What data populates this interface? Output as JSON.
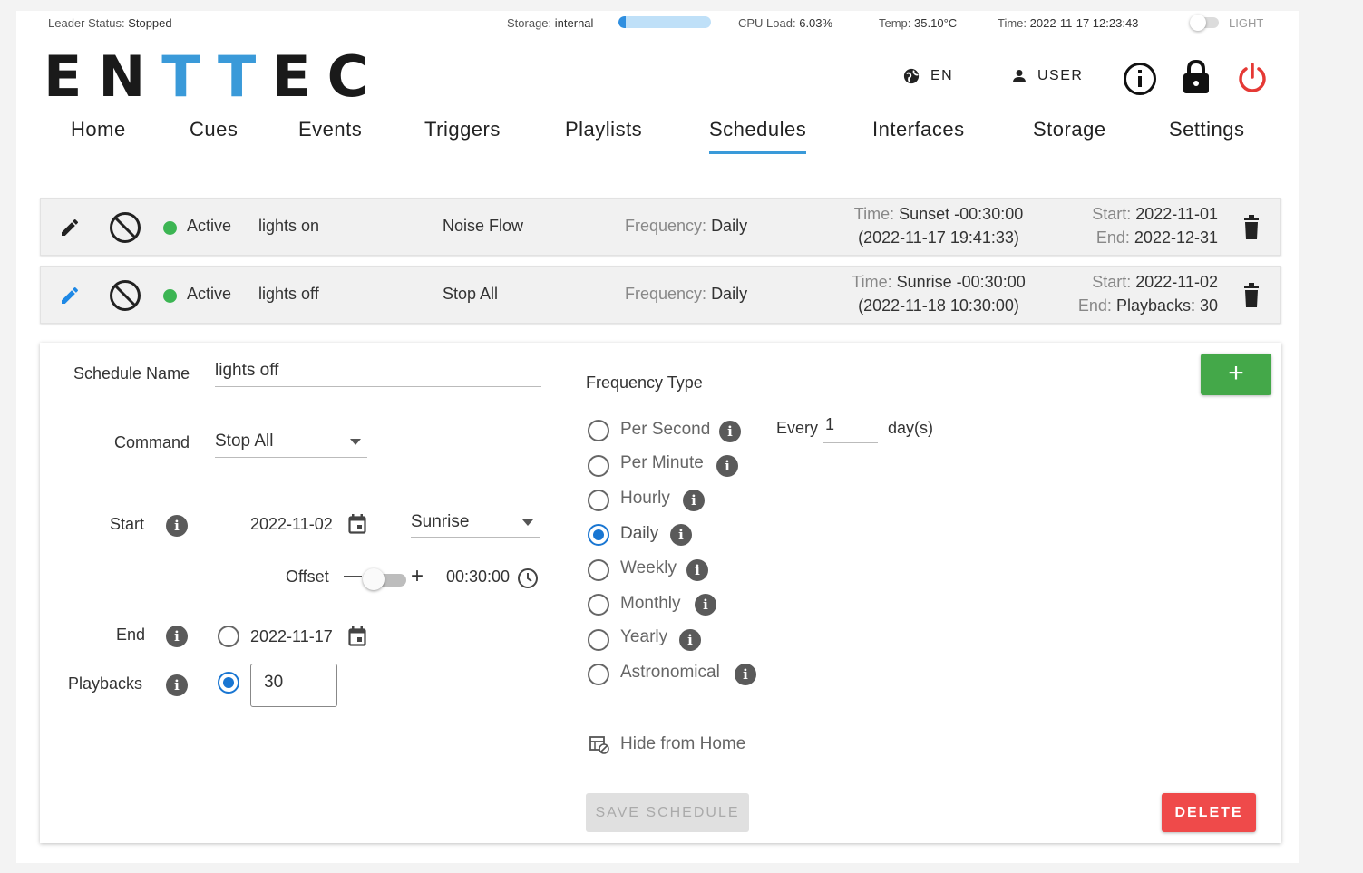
{
  "status_bar": {
    "leader_label": "Leader Status:",
    "leader_value": "Stopped",
    "storage_label": "Storage:",
    "storage_value": "internal",
    "storage_fraction": 0.08,
    "cpu_label": "CPU Load:",
    "cpu_value": "6.03%",
    "temp_label": "Temp:",
    "temp_value": "35.10°C",
    "time_label": "Time:",
    "time_value": "2022-11-17 12:23:43",
    "theme_label": "LIGHT"
  },
  "logo": {
    "part1": "EN",
    "part2": "TT",
    "part3": "EC"
  },
  "header": {
    "language": "EN",
    "user": "USER",
    "icons": [
      "globe-icon",
      "user-icon",
      "info-icon",
      "lock-icon",
      "power-icon"
    ]
  },
  "nav": {
    "items": [
      "Home",
      "Cues",
      "Events",
      "Triggers",
      "Playlists",
      "Schedules",
      "Interfaces",
      "Storage",
      "Settings"
    ],
    "active": "Schedules"
  },
  "schedules": [
    {
      "status": "Active",
      "name": "lights on",
      "command": "Noise Flow",
      "frequency_label": "Frequency:",
      "frequency": "Daily",
      "time_label": "Time:",
      "time": "Sunset -00:30:00",
      "time_next": "(2022-11-17 19:41:33)",
      "start_label": "Start:",
      "start": "2022-11-01",
      "end_label": "End:",
      "end": "2022-12-31"
    },
    {
      "status": "Active",
      "name": "lights off",
      "command": "Stop All",
      "frequency_label": "Frequency:",
      "frequency": "Daily",
      "time_label": "Time:",
      "time": "Sunrise -00:30:00",
      "time_next": "(2022-11-18 10:30:00)",
      "start_label": "Start:",
      "start": "2022-11-02",
      "end_label": "End:",
      "end": "Playbacks: 30"
    }
  ],
  "editor": {
    "schedule_name_label": "Schedule Name",
    "schedule_name": "lights off",
    "command_label": "Command",
    "command": "Stop All",
    "start_label": "Start",
    "start_date": "2022-11-02",
    "start_time_type": "Sunrise",
    "offset_label": "Offset",
    "offset_minus": "—",
    "offset_plus": "+",
    "offset_value": "00:30:00",
    "end_label": "End",
    "end_date": "2022-11-17",
    "playbacks_label": "Playbacks",
    "playbacks": "30",
    "frequency_type_label": "Frequency Type",
    "frequency_options": [
      "Per Second",
      "Per Minute",
      "Hourly",
      "Daily",
      "Weekly",
      "Monthly",
      "Yearly",
      "Astronomical"
    ],
    "frequency_selected": "Daily",
    "every_label": "Every",
    "every_value": "1",
    "every_unit": "day(s)",
    "hide_from_home": "Hide from Home",
    "add_label": "+",
    "save_label": "SAVE SCHEDULE",
    "delete_label": "DELETE"
  },
  "colors": {
    "accent": "#3a9ad9",
    "active_green": "#3cb553",
    "add_button": "#44a849",
    "delete_button": "#ef4a4a",
    "power_icon": "#e53935",
    "radio_selected": "#1976d2"
  }
}
